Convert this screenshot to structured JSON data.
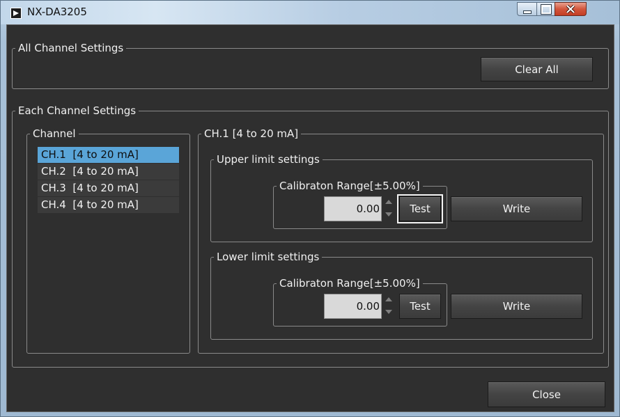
{
  "window": {
    "title": "NX-DA3205"
  },
  "all_channel": {
    "legend": "All Channel Settings",
    "clear_all_label": "Clear All"
  },
  "each_channel": {
    "legend": "Each Channel Settings",
    "channel_group": {
      "legend": "Channel",
      "items": [
        {
          "label": "CH.1  [4 to 20 mA]",
          "selected": true
        },
        {
          "label": "CH.2  [4 to 20 mA]",
          "selected": false
        },
        {
          "label": "CH.3  [4 to 20 mA]",
          "selected": false
        },
        {
          "label": "CH.4  [4 to 20 mA]",
          "selected": false
        }
      ]
    },
    "detail": {
      "legend": "CH.1  [4 to 20 mA]",
      "upper": {
        "legend": "Upper limit settings",
        "calib_legend": "Calibraton Range[±5.00%]",
        "value": "0.00",
        "test_label": "Test",
        "write_label": "Write"
      },
      "lower": {
        "legend": "Lower limit settings",
        "calib_legend": "Calibraton Range[±5.00%]",
        "value": "0.00",
        "test_label": "Test",
        "write_label": "Write"
      }
    }
  },
  "footer": {
    "close_label": "Close"
  },
  "icons": {
    "app": "app-icon",
    "minimize": "minimize-icon",
    "maximize": "maximize-icon",
    "close": "close-icon",
    "spin_up": "spin-up-icon",
    "spin_down": "spin-down-icon"
  },
  "colors": {
    "client_bg": "#2f2f2f",
    "selection": "#5aa5d8",
    "close_button": "#c33d24"
  }
}
